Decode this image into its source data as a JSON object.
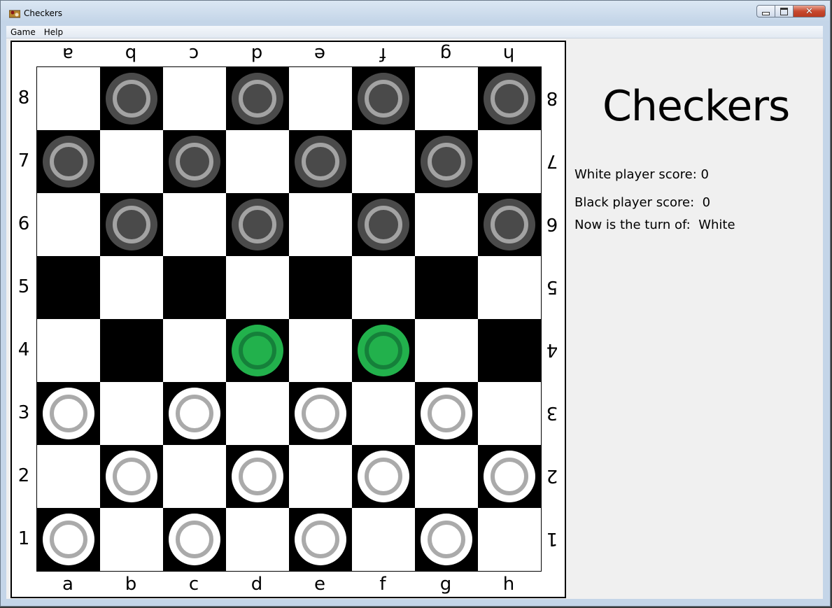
{
  "window": {
    "title": "Checkers",
    "close_glyph": "✕"
  },
  "menu": [
    "Game",
    "Help"
  ],
  "board": {
    "files": [
      "a",
      "b",
      "c",
      "d",
      "e",
      "f",
      "g",
      "h"
    ],
    "ranks": [
      "8",
      "7",
      "6",
      "5",
      "4",
      "3",
      "2",
      "1"
    ],
    "rows": [
      [
        "",
        "black",
        "",
        "black",
        "",
        "black",
        "",
        "black"
      ],
      [
        "black",
        "",
        "black",
        "",
        "black",
        "",
        "black",
        ""
      ],
      [
        "",
        "black",
        "",
        "black",
        "",
        "black",
        "",
        "black"
      ],
      [
        "",
        "",
        "",
        "",
        "",
        "",
        "",
        ""
      ],
      [
        "",
        "",
        "",
        "green",
        "",
        "green",
        "",
        ""
      ],
      [
        "white",
        "",
        "white",
        "",
        "white",
        "",
        "white",
        ""
      ],
      [
        "",
        "white",
        "",
        "white",
        "",
        "white",
        "",
        "white"
      ],
      [
        "white",
        "",
        "white",
        "",
        "white",
        "",
        "white",
        ""
      ]
    ],
    "highlight_color": "#22b14c"
  },
  "side": {
    "title": "Checkers",
    "white_score_label": "White player score:",
    "white_score": "0",
    "black_score_label": "Black player score:",
    "black_score": "0",
    "turn_label": "Now is the turn of:",
    "turn_value": "White"
  }
}
